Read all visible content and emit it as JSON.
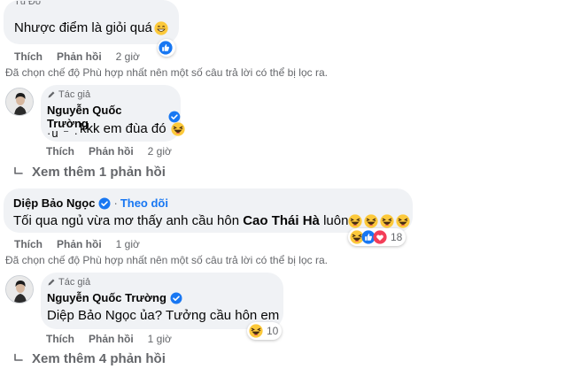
{
  "comments": [
    {
      "author_partial": "Tú Đỗ",
      "text": "Nhược điểm là giỏi quá",
      "actions": {
        "like": "Thích",
        "reply": "Phản hồi",
        "time": "2 giờ"
      },
      "filter_note": "Đã chọn chế độ Phù hợp nhất nên một số câu trả lời có thể bị lọc ra.",
      "reply": {
        "badge": "Tác giả",
        "author": "Nguyễn Quốc Trường",
        "text": "kkk em đùa đó",
        "actions": {
          "like": "Thích",
          "reply": "Phản hồi",
          "time": "2 giờ"
        }
      },
      "more_replies": "Xem thêm 1 phản hồi"
    },
    {
      "author": "Diệp Bảo Ngọc",
      "follow": "Theo dõi",
      "text_pre": "Tối qua ngủ vừa mơ thấy anh cầu hôn ",
      "text_bold": "Cao Thái Hà",
      "text_post": " luôn",
      "reaction_count": "18",
      "actions": {
        "like": "Thích",
        "reply": "Phản hồi",
        "time": "1 giờ"
      },
      "filter_note": "Đã chọn chế độ Phù hợp nhất nên một số câu trả lời có thể bị lọc ra.",
      "reply": {
        "badge": "Tác giả",
        "author": "Nguyễn Quốc Trường",
        "text": "Diệp Bảo Ngọc ủa? Tưởng cầu hôn em",
        "reaction_count": "10",
        "actions": {
          "like": "Thích",
          "reply": "Phản hồi",
          "time": "1 giờ"
        }
      },
      "more_replies": "Xem thêm 4 phản hồi"
    }
  ],
  "colors": {
    "bubble": "#f0f2f5",
    "meta": "#65676b",
    "link": "#1877f2",
    "text": "#050505"
  }
}
